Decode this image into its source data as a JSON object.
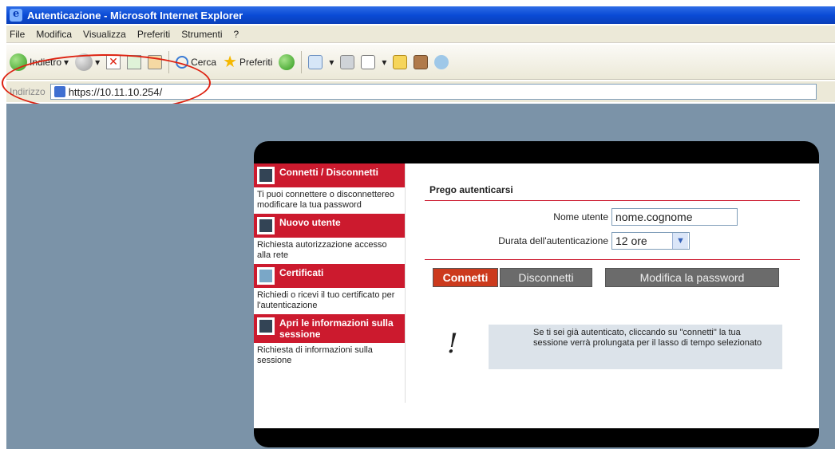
{
  "window": {
    "title": "Autenticazione - Microsoft Internet Explorer"
  },
  "menu": [
    "File",
    "Modifica",
    "Visualizza",
    "Preferiti",
    "Strumenti",
    "?"
  ],
  "toolbar": {
    "back_label": "Indietro",
    "search_label": "Cerca",
    "favorites_label": "Preferiti"
  },
  "address": {
    "label": "Indirizzo",
    "url": "https://10.11.10.254/"
  },
  "left_menu": {
    "connect": {
      "title": "Connetti / Disconnetti",
      "desc": "Ti puoi connettere o disconnettereo modificare la tua password"
    },
    "new_user": {
      "title": "Nuovo utente",
      "desc": "Richiesta autorizzazione accesso alla rete"
    },
    "certificates": {
      "title": "Certificati",
      "desc": "Richiedi o ricevi il tuo certificato per l'autenticazione"
    },
    "session": {
      "title": "Apri le informazioni sulla sessione",
      "desc": "Richiesta di informazioni sulla sessione"
    }
  },
  "form": {
    "title": "Prego autenticarsi",
    "username_label": "Nome utente",
    "username_value": "nome.cognome",
    "duration_label": "Durata dell'autenticazione",
    "duration_value": "12 ore",
    "connect_button": "Connetti",
    "disconnect_button": "Disconnetti",
    "change_password_button": "Modifica la password",
    "info_text": "Se ti sei già autenticato, cliccando su \"connetti\" la tua sessione verrà prolungata per il lasso di tempo selezionato"
  },
  "colors": {
    "accent_red": "#cc1a2e",
    "content_bg": "#7b93a8"
  }
}
